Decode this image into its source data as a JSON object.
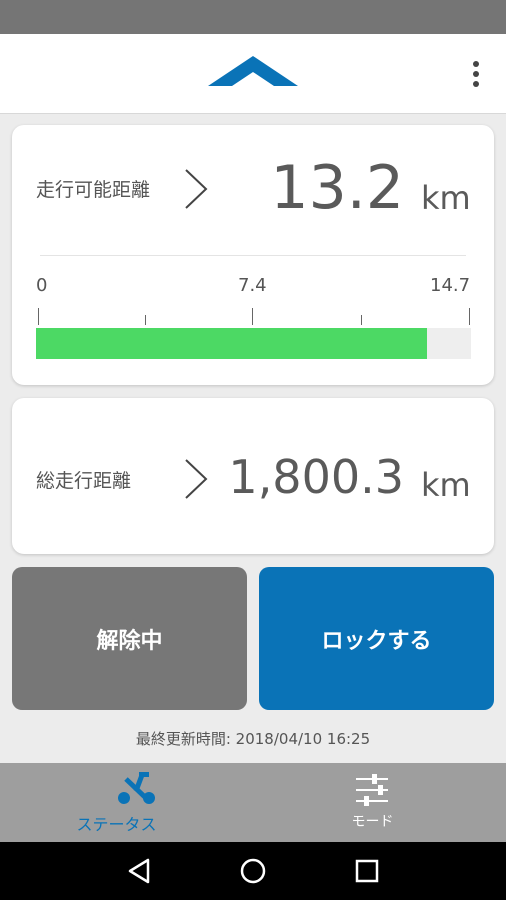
{
  "app_bar": {
    "logo_icon": "chevron-up-logo",
    "menu_icon": "more-vertical-icon"
  },
  "range": {
    "label": "走行可能距離",
    "value": "13.2",
    "unit": "km",
    "scale": {
      "min": "0",
      "mid": "7.4",
      "max": "14.7"
    },
    "fill_fraction": 0.898,
    "fill_color": "#4cd964"
  },
  "odometer": {
    "label": "総走行距離",
    "value": "1,800.3",
    "unit": "km"
  },
  "buttons": {
    "unlock_label": "解除中",
    "lock_label": "ロックする",
    "unlock_color": "#777777",
    "lock_color": "#0a73b7"
  },
  "last_updated": "最終更新時間: 2018/04/10 16:25",
  "bottom_nav": {
    "status_label": "ステータス",
    "mode_label": "モード",
    "active_color": "#0a73b7"
  },
  "system_nav": {
    "back_icon": "back-triangle-icon",
    "home_icon": "home-circle-icon",
    "recents_icon": "recents-square-icon"
  }
}
